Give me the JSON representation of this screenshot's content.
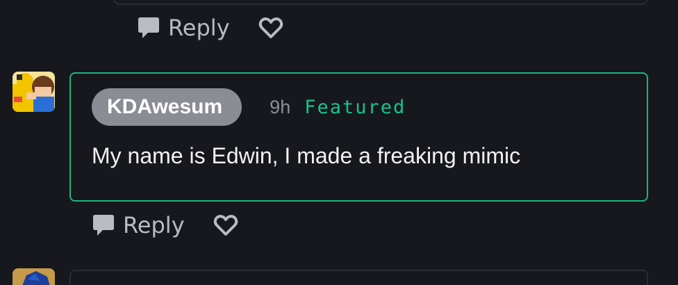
{
  "previous_comment": {
    "actions": {
      "reply_label": "Reply",
      "reply_icon": "comment-bubble-icon",
      "like_icon": "heart-outline-icon"
    }
  },
  "featured_comment": {
    "username": "KDAwesum",
    "time": "9h",
    "badge": "Featured",
    "body": "My name is Edwin, I made a freaking mimic",
    "avatar_icon": "user-avatar-image",
    "accent_color": "#1eb57f",
    "actions": {
      "reply_label": "Reply",
      "reply_icon": "comment-bubble-icon",
      "like_icon": "heart-outline-icon"
    }
  },
  "next_comment": {
    "avatar_icon": "user-avatar-image"
  }
}
